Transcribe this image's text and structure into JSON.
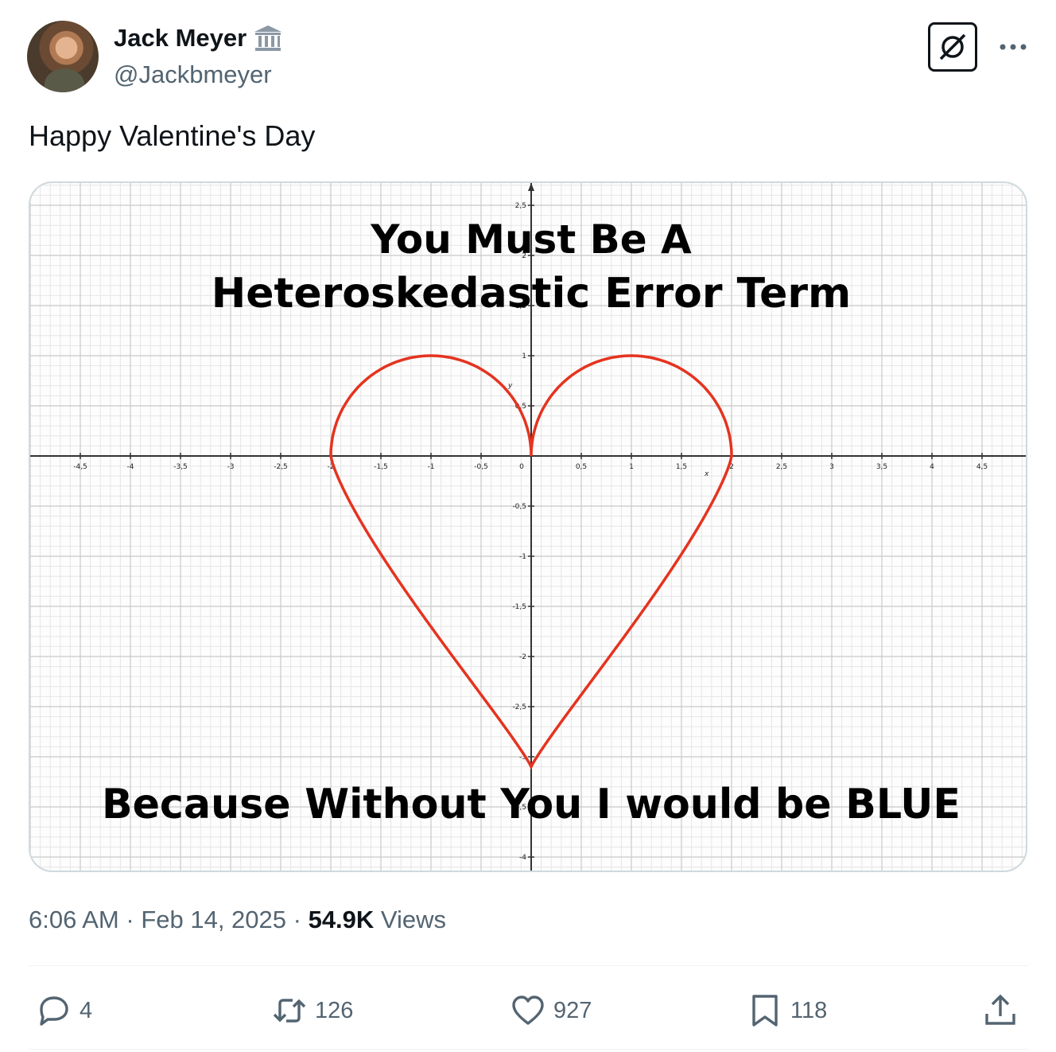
{
  "author": {
    "display_name": "Jack Meyer",
    "handle": "@Jackbmeyer",
    "badge_icon": "government-building-icon"
  },
  "tweet": {
    "text": "Happy Valentine's Day",
    "time": "6:06 AM",
    "separator": " · ",
    "date": "Feb 14, 2025",
    "views_count": "54.9K",
    "views_label": " Views"
  },
  "media": {
    "caption_top_line1": "You Must Be A",
    "caption_top_line2": "Heteroskedastic Error Term",
    "caption_bottom": "Because Without You I would be BLUE",
    "heart_color": "#e5331f",
    "x_axis_label": "x",
    "y_axis_label": "y",
    "x_ticks": [
      "-4,5",
      "-4",
      "-3,5",
      "-3",
      "-2,5",
      "-2",
      "-1,5",
      "-1",
      "-0,5",
      "0",
      "0,5",
      "1",
      "1,5",
      "2",
      "2,5",
      "3",
      "3,5",
      "4",
      "4,5"
    ],
    "y_ticks": [
      "2,5",
      "2",
      "1,5",
      "1",
      "0,5",
      "-0,5",
      "-1",
      "-1,5",
      "-2",
      "-2,5",
      "-3",
      "-3,5",
      "-4"
    ]
  },
  "actions": {
    "replies": "4",
    "reposts": "126",
    "likes": "927",
    "bookmarks": "118"
  }
}
